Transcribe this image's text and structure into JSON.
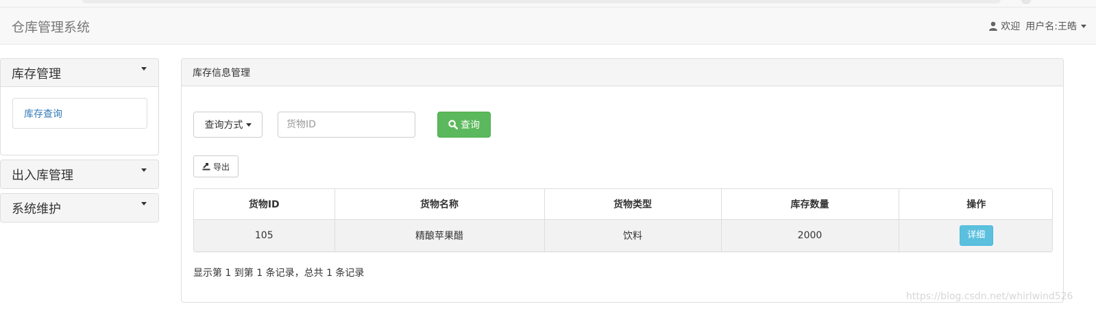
{
  "header": {
    "brand": "仓库管理系统",
    "welcome": "欢迎",
    "username": "用户名:王皓"
  },
  "sidebar": {
    "groups": [
      {
        "title": "库存管理",
        "items": [
          {
            "label": "库存查询"
          }
        ]
      },
      {
        "title": "出入库管理"
      },
      {
        "title": "系统维护"
      }
    ]
  },
  "main": {
    "title": "库存信息管理",
    "query": {
      "mode_label": "查询方式",
      "input_placeholder": "货物ID",
      "input_value": "",
      "search_label": "查询"
    },
    "export_label": "导出",
    "table": {
      "columns": [
        "货物ID",
        "货物名称",
        "货物类型",
        "库存数量",
        "操作"
      ],
      "rows": [
        {
          "id": "105",
          "name": "精酿苹果醋",
          "type": "饮料",
          "quantity": "2000",
          "action": "详细"
        }
      ]
    },
    "record_summary": "显示第 1 到第 1 条记录，总共 1 条记录"
  },
  "watermark": "https://blog.csdn.net/whirlwind526",
  "colors": {
    "success": "#5cb85c",
    "info": "#5bc0de",
    "link": "#337ab7"
  }
}
